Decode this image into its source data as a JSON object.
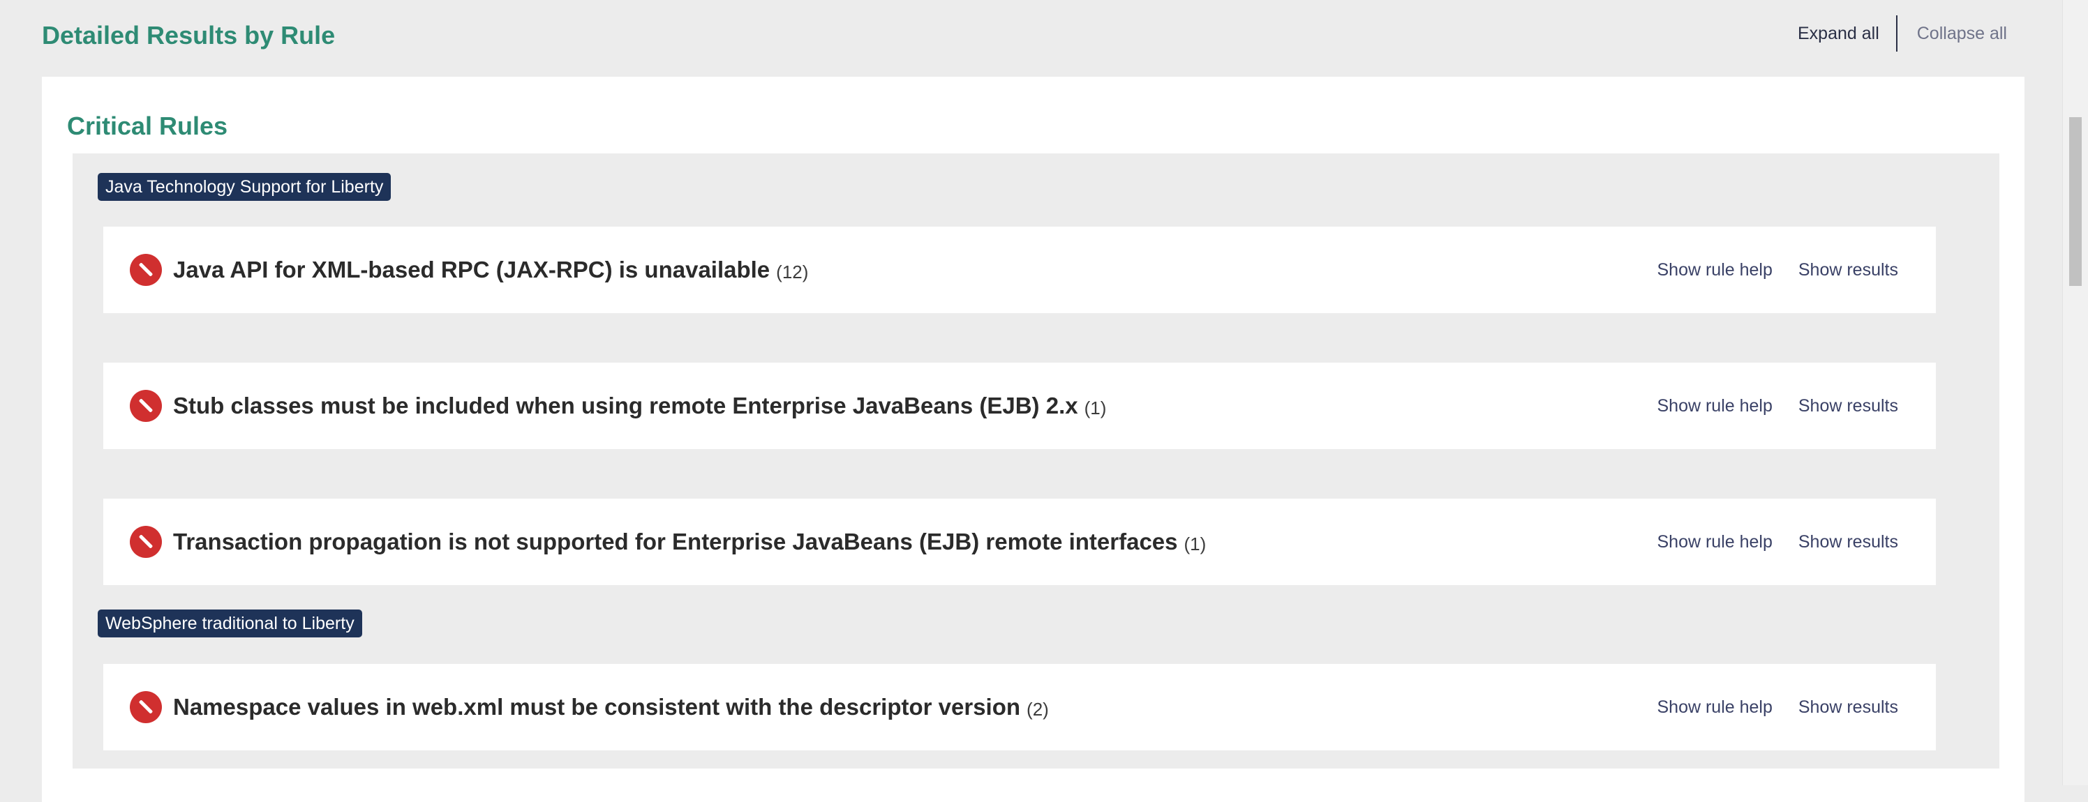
{
  "header": {
    "title": "Detailed Results by Rule",
    "expand_all": "Expand all",
    "collapse_all": "Collapse all"
  },
  "section": {
    "title": "Critical Rules"
  },
  "groups": [
    {
      "tag": "Java Technology Support for Liberty",
      "rules": [
        {
          "title": "Java API for XML-based RPC (JAX-RPC) is unavailable",
          "count": "(12)",
          "help_label": "Show rule help",
          "results_label": "Show results"
        },
        {
          "title": "Stub classes must be included when using remote Enterprise JavaBeans (EJB) 2.x",
          "count": "(1)",
          "help_label": "Show rule help",
          "results_label": "Show results"
        },
        {
          "title": "Transaction propagation is not supported for Enterprise JavaBeans (EJB) remote interfaces",
          "count": "(1)",
          "help_label": "Show rule help",
          "results_label": "Show results"
        }
      ]
    },
    {
      "tag": "WebSphere traditional to Liberty",
      "rules": [
        {
          "title": "Namespace values in web.xml must be consistent with the descriptor version",
          "count": "(2)",
          "help_label": "Show rule help",
          "results_label": "Show results"
        }
      ]
    }
  ],
  "icons": {
    "rule_severity": "critical-no-entry-icon"
  },
  "colors": {
    "heading": "#2e8b74",
    "tag_background": "#1e3358",
    "critical_icon": "#d02f2f",
    "link": "#3a4166"
  }
}
